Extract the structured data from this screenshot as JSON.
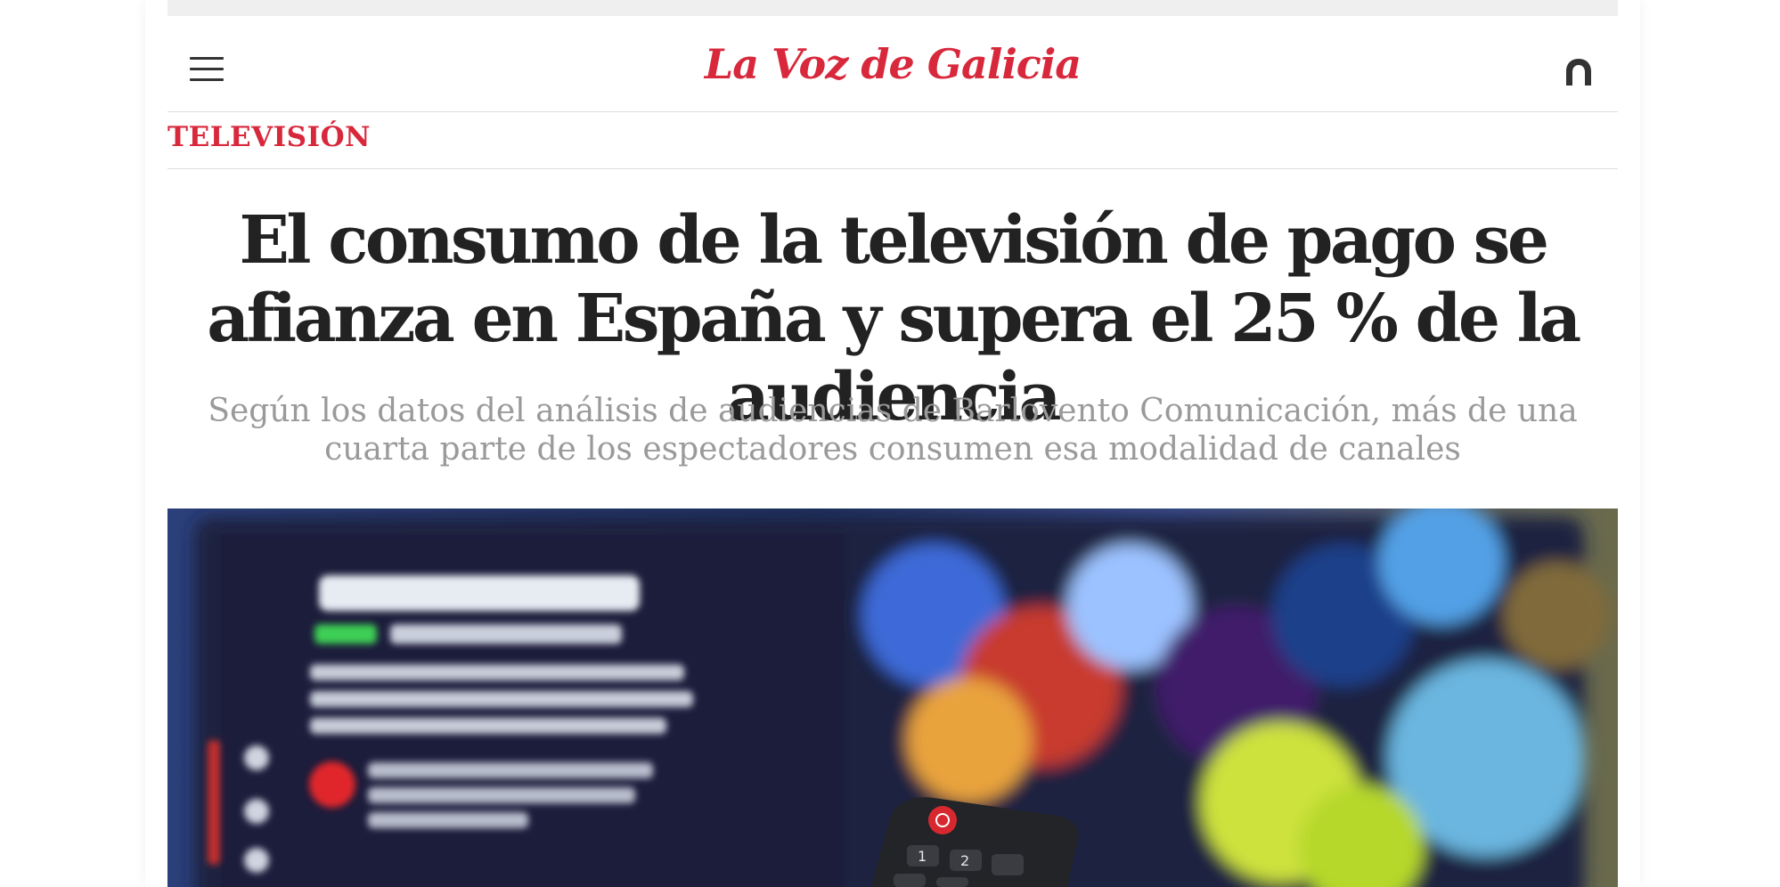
{
  "header": {
    "logo": "La Voz de Galicia",
    "menu_icon": "hamburger-menu-icon",
    "user_icon": "user-icon"
  },
  "section": {
    "label": "TELEVISIÓN"
  },
  "article": {
    "headline": "El consumo de la televisión de pago se afianza en España y supera el 25 % de la audiencia",
    "subtitle": "Según los datos del análisis de audiencias de Barlovento Comunicación, más de una cuarta parte de los espectadores consumen esa modalidad de canales"
  },
  "colors": {
    "brand": "#d8283c",
    "headline": "#222222",
    "subtitle": "#9a9a9a"
  }
}
